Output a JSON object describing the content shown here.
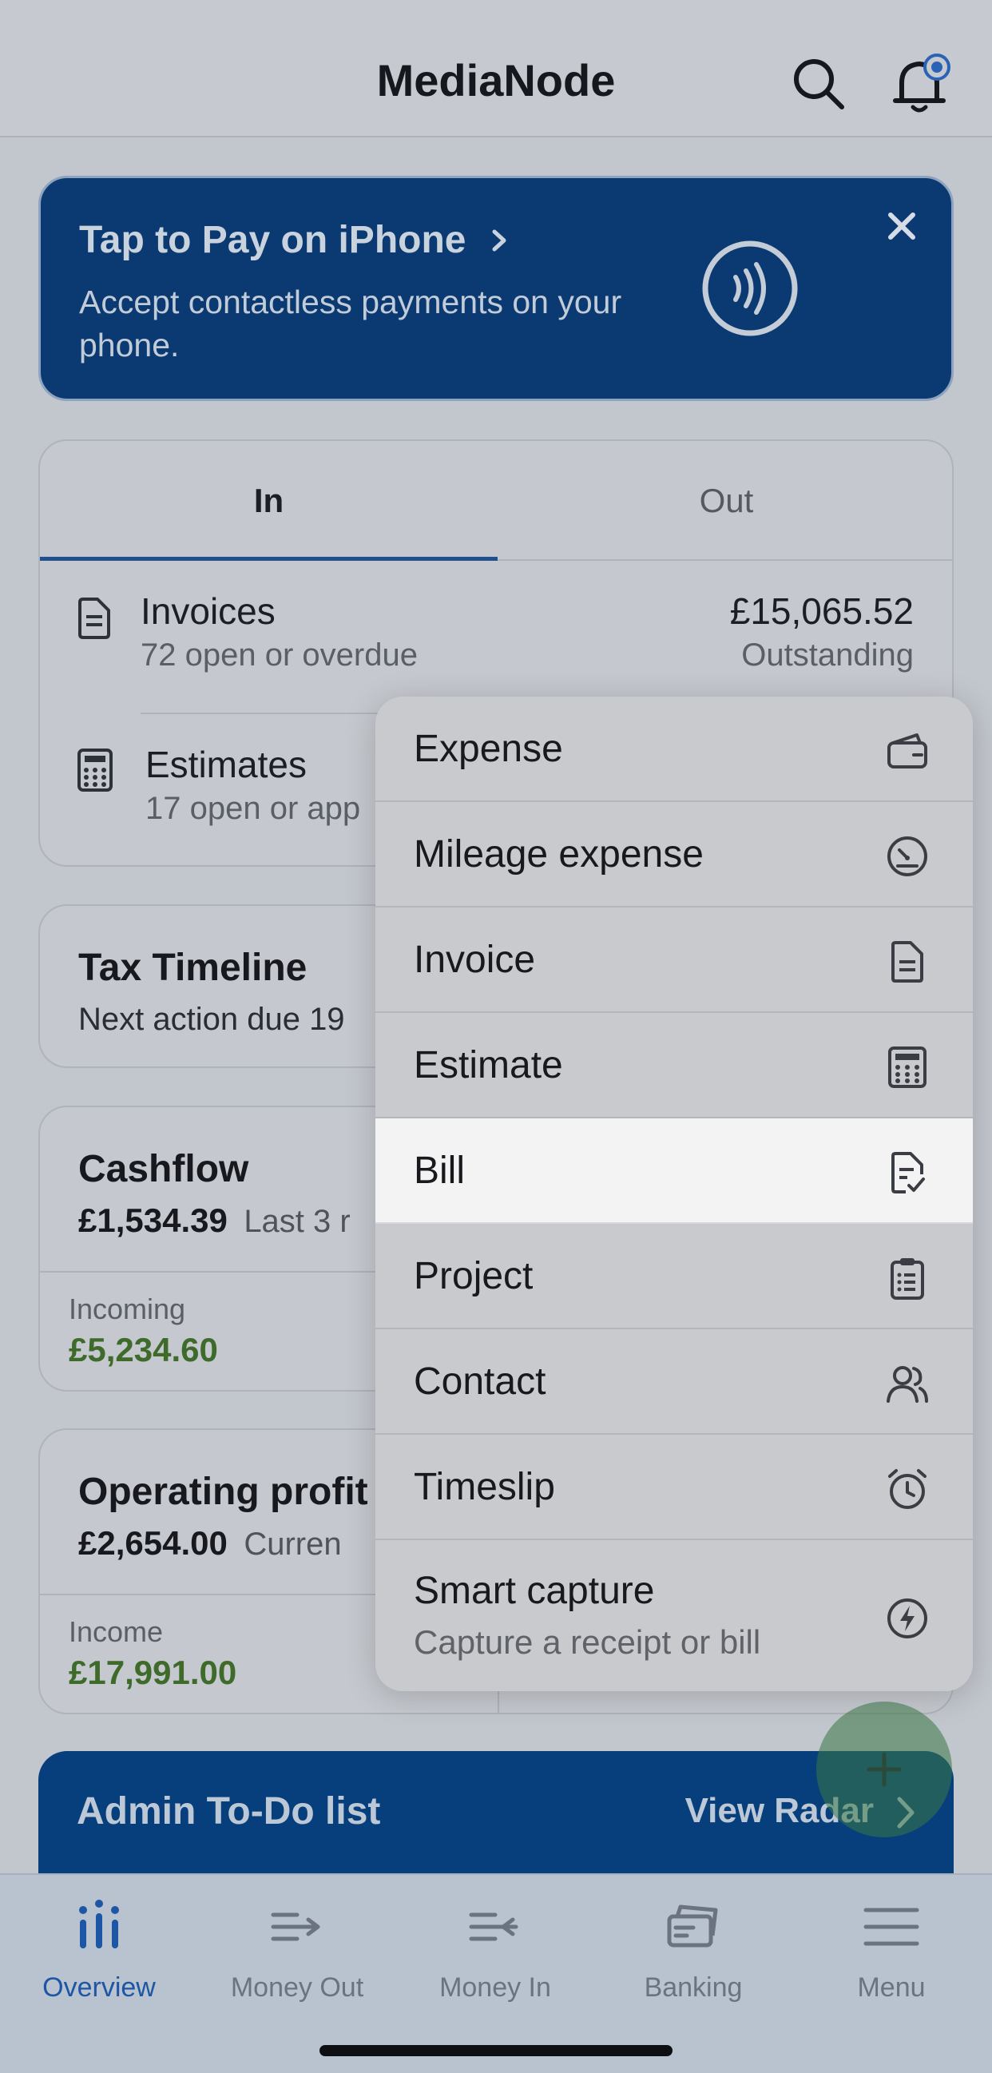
{
  "header": {
    "title": "MediaNode"
  },
  "banner": {
    "title": "Tap to Pay on iPhone",
    "subtitle": "Accept contactless payments on your phone."
  },
  "in_out_card": {
    "tabs": [
      "In",
      "Out"
    ],
    "active_tab": "In",
    "rows": [
      {
        "label": "Invoices",
        "sub": "72 open or overdue",
        "amount": "£15,065.52",
        "amount_sub": "Outstanding"
      },
      {
        "label": "Estimates",
        "sub": "17 open or app"
      }
    ]
  },
  "tax_timeline": {
    "title": "Tax Timeline",
    "sub": "Next action due 19"
  },
  "cashflow": {
    "title": "Cashflow",
    "amount": "£1,534.39",
    "period": "Last 3 r",
    "incoming_label": "Incoming",
    "incoming_value": "£5,234.60"
  },
  "operating_profit": {
    "title": "Operating profit",
    "amount": "£2,654.00",
    "period": "Curren",
    "income_label": "Income",
    "income_value": "£17,991.00"
  },
  "admin_todo": {
    "title": "Admin To-Do list",
    "link": "View Radar"
  },
  "create_menu": {
    "items": [
      {
        "label": "Expense",
        "icon": "wallet-icon"
      },
      {
        "label": "Mileage expense",
        "icon": "speedometer-icon"
      },
      {
        "label": "Invoice",
        "icon": "invoice-icon"
      },
      {
        "label": "Estimate",
        "icon": "calculator-icon"
      },
      {
        "label": "Bill",
        "icon": "bill-icon",
        "selected": true
      },
      {
        "label": "Project",
        "icon": "clipboard-icon"
      },
      {
        "label": "Contact",
        "icon": "contacts-icon"
      },
      {
        "label": "Timeslip",
        "icon": "alarm-clock-icon"
      },
      {
        "label": "Smart capture",
        "sub": "Capture a receipt or bill",
        "icon": "bolt-icon"
      }
    ]
  },
  "bottom_nav": {
    "items": [
      {
        "label": "Overview",
        "icon": "overview-icon",
        "active": true
      },
      {
        "label": "Money Out",
        "icon": "money-out-icon"
      },
      {
        "label": "Money In",
        "icon": "money-in-icon"
      },
      {
        "label": "Banking",
        "icon": "banking-icon"
      },
      {
        "label": "Menu",
        "icon": "menu-icon"
      }
    ]
  },
  "colors": {
    "brand_blue": "#0b3a72",
    "active_tab": "#1f4f8c",
    "positive_green": "#3f6b2a",
    "nav_active": "#1c56a4"
  }
}
